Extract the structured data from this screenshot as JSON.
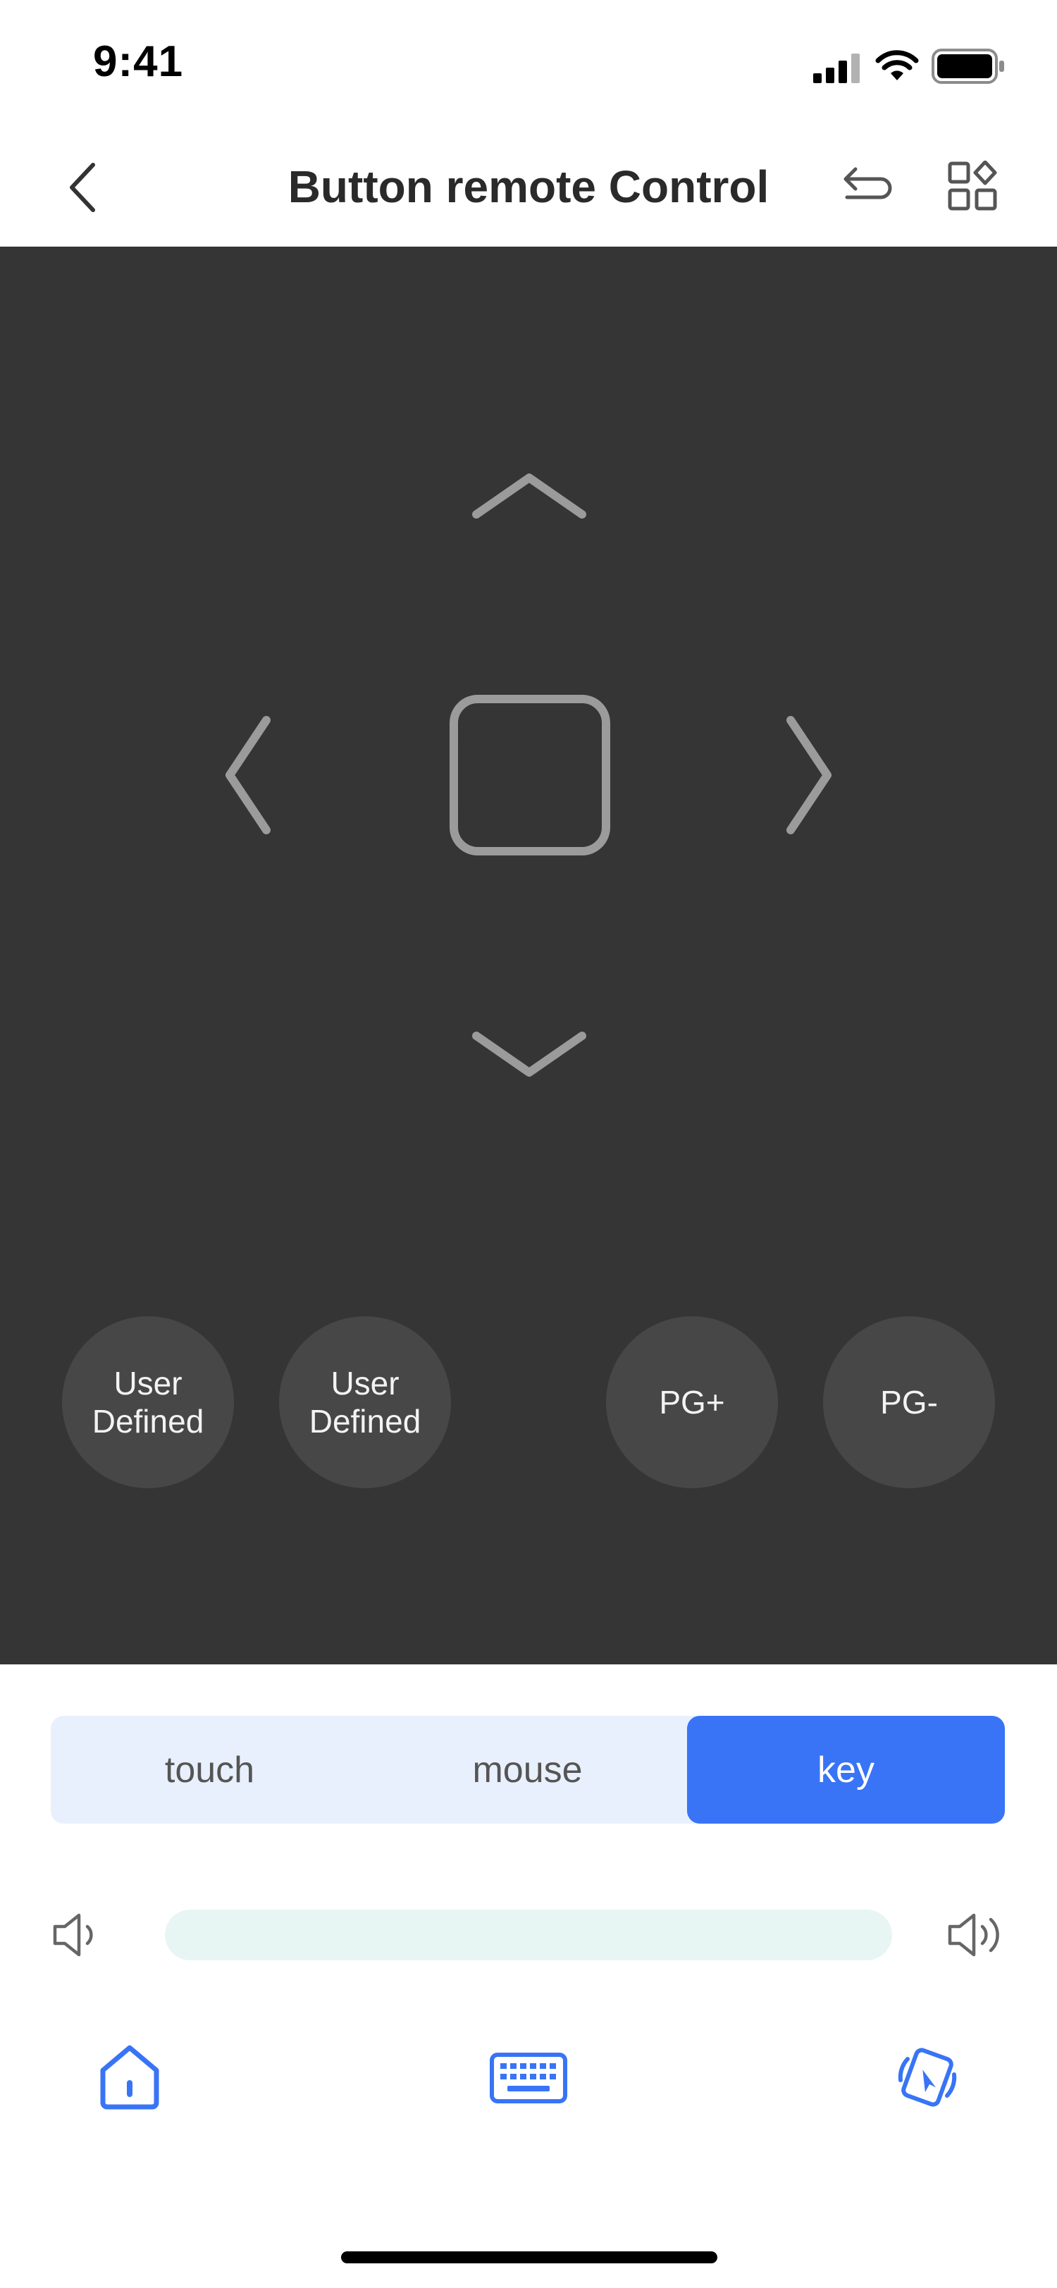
{
  "status_bar": {
    "time": "9:41"
  },
  "header": {
    "title": "Button remote Control"
  },
  "remote": {
    "custom_buttons": [
      {
        "line1": "User",
        "line2": "Defined"
      },
      {
        "line1": "User",
        "line2": "Defined"
      }
    ],
    "page_buttons": [
      "PG+",
      "PG-"
    ]
  },
  "modes": {
    "tabs": [
      "touch",
      "mouse",
      "key"
    ],
    "selected": "key"
  },
  "colors": {
    "accent": "#3874f5",
    "pad_background": "#353535",
    "round_button": "#474747",
    "mode_bg": "#e9f0fd",
    "volume_track": "#e8f6f3"
  },
  "icons": {
    "status": [
      "signal-icon",
      "wifi-icon",
      "battery-icon"
    ],
    "header": [
      "back-icon",
      "undo-icon",
      "grid-icon"
    ],
    "dpad": [
      "arrow-up-icon",
      "arrow-left-icon",
      "ok-square-icon",
      "arrow-right-icon",
      "arrow-down-icon"
    ],
    "volume": [
      "volume-down-icon",
      "volume-up-icon"
    ],
    "toolbar": [
      "home-icon",
      "keyboard-icon",
      "cast-icon"
    ]
  }
}
